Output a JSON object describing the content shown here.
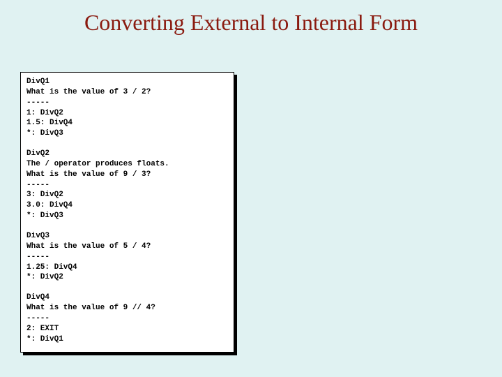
{
  "title": "Converting External to Internal Form",
  "blocks": {
    "q1": "DivQ1\nWhat is the value of 3 / 2?\n-----\n1: DivQ2\n1.5: DivQ4\n*: DivQ3",
    "q2": "DivQ2\nThe / operator produces floats.\nWhat is the value of 9 / 3?\n-----\n3: DivQ2\n3.0: DivQ4\n*: DivQ3",
    "q3": "DivQ3\nWhat is the value of 5 / 4?\n-----\n1.25: DivQ4\n*: DivQ2",
    "q4": "DivQ4\nWhat is the value of 9 // 4?\n-----\n2: EXIT\n*: DivQ1"
  }
}
